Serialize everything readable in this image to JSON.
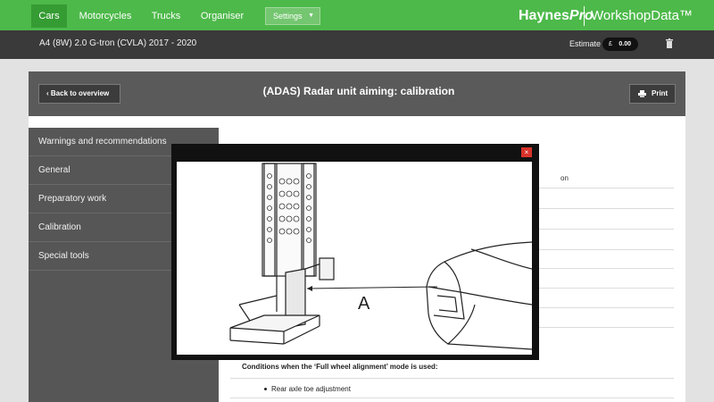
{
  "nav": {
    "tabs": [
      {
        "label": "Cars",
        "active": true
      },
      {
        "label": "Motorcycles",
        "active": false
      },
      {
        "label": "Trucks",
        "active": false
      },
      {
        "label": "Organiser",
        "active": false
      }
    ],
    "settings_label": "Settings",
    "brand": {
      "part1": "Haynes",
      "part2": "Pro",
      "product": "WorkshopData™"
    },
    "accent": "#4db94a"
  },
  "vehicle_bar": {
    "title": "A4 (8W) 2.0 G-tron (CVLA) 2017 - 2020",
    "estimate_label": "Estimate",
    "currency": "£",
    "amount": "0.00",
    "trash_icon": "trash-icon"
  },
  "page": {
    "back_label": "Back to overview",
    "title": "(ADAS) Radar unit aiming: calibration",
    "print_label": "Print"
  },
  "sidebar": {
    "items": [
      {
        "label": "Warnings and recommendations"
      },
      {
        "label": "General"
      },
      {
        "label": "Preparatory work"
      },
      {
        "label": "Calibration"
      },
      {
        "label": "Special tools"
      }
    ]
  },
  "content": {
    "fragment": "on",
    "conditions_heading": "Conditions when the ‘Full wheel alignment’ mode is used:",
    "bullet": "Rear axle toe adjustment"
  },
  "modal": {
    "close_glyph": "×",
    "figure_label": "A"
  }
}
